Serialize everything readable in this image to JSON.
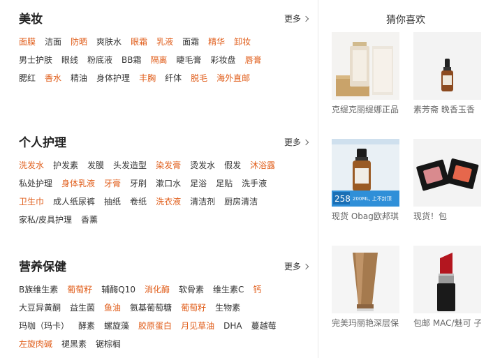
{
  "sections": [
    {
      "title": "美妆",
      "more": "更多",
      "rows": [
        [
          {
            "t": "面膜",
            "h": true
          },
          {
            "t": "洁面",
            "h": false
          },
          {
            "t": "防晒",
            "h": true
          },
          {
            "t": "爽肤水",
            "h": false
          },
          {
            "t": "眼霜",
            "h": true
          },
          {
            "t": "乳液",
            "h": true
          },
          {
            "t": "面霜",
            "h": false
          },
          {
            "t": "精华",
            "h": true
          },
          {
            "t": "卸妆",
            "h": true
          }
        ],
        [
          {
            "t": "男士护肤",
            "h": false
          },
          {
            "t": "眼线",
            "h": false
          },
          {
            "t": "粉底液",
            "h": false
          },
          {
            "t": "BB霜",
            "h": false
          },
          {
            "t": "隔离",
            "h": true
          },
          {
            "t": "睫毛膏",
            "h": false
          },
          {
            "t": "彩妆盘",
            "h": false
          },
          {
            "t": "唇膏",
            "h": true
          }
        ],
        [
          {
            "t": "腮红",
            "h": false
          },
          {
            "t": "香水",
            "h": true
          },
          {
            "t": "精油",
            "h": false
          },
          {
            "t": "身体护理",
            "h": false
          },
          {
            "t": "丰胸",
            "h": true
          },
          {
            "t": "纤体",
            "h": false
          },
          {
            "t": "脱毛",
            "h": true
          },
          {
            "t": "海外直邮",
            "h": true
          }
        ]
      ]
    },
    {
      "title": "个人护理",
      "more": "更多",
      "rows": [
        [
          {
            "t": "洗发水",
            "h": true
          },
          {
            "t": "护发素",
            "h": false
          },
          {
            "t": "发膜",
            "h": false
          },
          {
            "t": "头发造型",
            "h": false
          },
          {
            "t": "染发膏",
            "h": true
          },
          {
            "t": "烫发水",
            "h": false
          },
          {
            "t": "假发",
            "h": false
          },
          {
            "t": "沐浴露",
            "h": true
          }
        ],
        [
          {
            "t": "私处护理",
            "h": false
          },
          {
            "t": "身体乳液",
            "h": true
          },
          {
            "t": "牙膏",
            "h": true
          },
          {
            "t": "牙刷",
            "h": false
          },
          {
            "t": "漱口水",
            "h": false
          },
          {
            "t": "足浴",
            "h": false
          },
          {
            "t": "足贴",
            "h": false
          },
          {
            "t": "洗手液",
            "h": false
          }
        ],
        [
          {
            "t": "卫生巾",
            "h": true
          },
          {
            "t": "成人纸尿裤",
            "h": false
          },
          {
            "t": "抽纸",
            "h": false
          },
          {
            "t": "卷纸",
            "h": false
          },
          {
            "t": "洗衣液",
            "h": true
          },
          {
            "t": "清洁剂",
            "h": false
          },
          {
            "t": "厨房清洁",
            "h": false
          }
        ],
        [
          {
            "t": "家私/皮具护理",
            "h": false
          },
          {
            "t": "香薰",
            "h": false
          }
        ]
      ]
    },
    {
      "title": "营养保健",
      "more": "更多",
      "rows": [
        [
          {
            "t": "B族维生素",
            "h": false
          },
          {
            "t": "葡萄籽",
            "h": true
          },
          {
            "t": "辅酶Q10",
            "h": false
          },
          {
            "t": "消化酶",
            "h": true
          },
          {
            "t": "软骨素",
            "h": false
          },
          {
            "t": "维生素C",
            "h": false
          },
          {
            "t": "钙",
            "h": true
          }
        ],
        [
          {
            "t": "大豆异黄酮",
            "h": false
          },
          {
            "t": "益生菌",
            "h": false
          },
          {
            "t": "鱼油",
            "h": true
          },
          {
            "t": "氨基葡萄糖",
            "h": false
          },
          {
            "t": "葡萄籽",
            "h": true
          },
          {
            "t": "生物素",
            "h": false
          }
        ],
        [
          {
            "t": "玛咖（玛卡）",
            "h": false
          },
          {
            "t": "酵素",
            "h": false
          },
          {
            "t": "螺旋藻",
            "h": false
          },
          {
            "t": "胶原蛋白",
            "h": true
          },
          {
            "t": "月见草油",
            "h": true
          },
          {
            "t": "DHA",
            "h": false
          },
          {
            "t": "蔓越莓",
            "h": false
          }
        ],
        [
          {
            "t": "左旋肉碱",
            "h": true
          },
          {
            "t": "褪黑素",
            "h": false
          },
          {
            "t": "锯棕榈",
            "h": false
          }
        ]
      ]
    }
  ],
  "recommend": {
    "title": "猜你喜欢",
    "products": [
      {
        "name": "克缇克丽缇娜正品",
        "icon": "serum-bottle-box-image"
      },
      {
        "name": "素芳斋 晚香玉香",
        "icon": "dropper-bottle-image"
      },
      {
        "name": "现货 Obag欧邦琪",
        "icon": "obagi-serum-promo-image",
        "promo_price": "258",
        "promo_text": "200ML, 上不封顶"
      },
      {
        "name": "现货！包",
        "icon": "blush-palette-image"
      },
      {
        "name": "完美玛丽艳深层保",
        "icon": "cleanser-tube-image"
      },
      {
        "name": "包邮 MAC/魅可 子",
        "icon": "lipstick-image"
      }
    ]
  },
  "colors": {
    "highlight": "#e05d1a",
    "text": "#333333",
    "divider": "#e8e8e8"
  }
}
